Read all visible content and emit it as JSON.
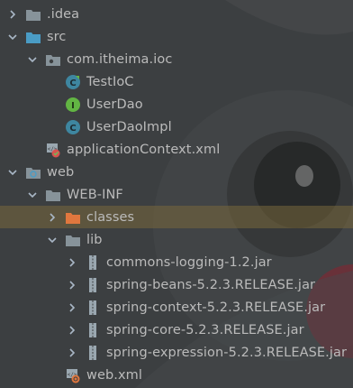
{
  "project_tree": {
    "items": [
      {
        "label": ".idea",
        "expanded": false,
        "icon": "folder-icon"
      },
      {
        "label": "src",
        "expanded": true,
        "icon": "source-folder-icon"
      },
      {
        "label": "com.itheima.ioc",
        "expanded": true,
        "icon": "package-icon"
      },
      {
        "label": "TestIoC",
        "icon": "class-icon"
      },
      {
        "label": "UserDao",
        "icon": "interface-icon"
      },
      {
        "label": "UserDaoImpl",
        "icon": "class-icon"
      },
      {
        "label": "applicationContext.xml",
        "icon": "spring-xml-icon"
      },
      {
        "label": "web",
        "expanded": true,
        "icon": "web-folder-icon"
      },
      {
        "label": "WEB-INF",
        "expanded": true,
        "icon": "folder-icon"
      },
      {
        "label": "classes",
        "expanded": false,
        "icon": "excluded-folder-icon",
        "selected": true
      },
      {
        "label": "lib",
        "expanded": true,
        "icon": "folder-icon"
      },
      {
        "label": "commons-logging-1.2.jar",
        "expanded": false,
        "icon": "jar-icon"
      },
      {
        "label": "spring-beans-5.2.3.RELEASE.jar",
        "expanded": false,
        "icon": "jar-icon"
      },
      {
        "label": "spring-context-5.2.3.RELEASE.jar",
        "expanded": false,
        "icon": "jar-icon"
      },
      {
        "label": "spring-core-5.2.3.RELEASE.jar",
        "expanded": false,
        "icon": "jar-icon"
      },
      {
        "label": "spring-expression-5.2.3.RELEASE.jar",
        "expanded": false,
        "icon": "jar-icon"
      },
      {
        "label": "web.xml",
        "icon": "web-xml-icon"
      }
    ]
  },
  "colors": {
    "background": "#3c3f41",
    "text": "#bbbbbb",
    "folder": "#87939a",
    "source_folder": "#4a9cc5",
    "class": "#3e86a0",
    "interface": "#62b543",
    "excluded_folder": "#e0773e",
    "selection": "#6b5f3a"
  }
}
